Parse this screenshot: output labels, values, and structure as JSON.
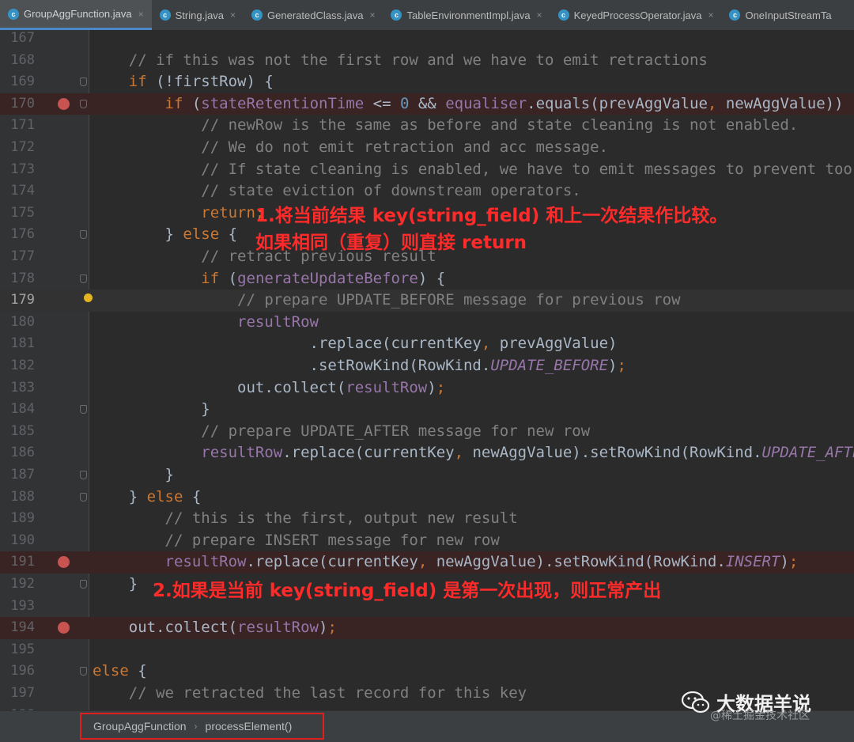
{
  "tabs": [
    {
      "label": "GroupAggFunction.java",
      "active": true
    },
    {
      "label": "String.java",
      "active": false
    },
    {
      "label": "GeneratedClass.java",
      "active": false
    },
    {
      "label": "TableEnvironmentImpl.java",
      "active": false
    },
    {
      "label": "KeyedProcessOperator.java",
      "active": false
    },
    {
      "label": "OneInputStreamTa",
      "active": false
    }
  ],
  "tab_icon_letter": "c",
  "tab_close_glyph": "×",
  "code_lines": [
    {
      "num": "167",
      "tokens": []
    },
    {
      "num": "168",
      "tokens": [
        {
          "t": "    // if this was not the first row and we have to emit retractions",
          "c": "c"
        }
      ]
    },
    {
      "num": "169",
      "tokens": [
        {
          "t": "    "
        },
        {
          "t": "if",
          "c": "k"
        },
        {
          "t": " (!firstRow) {"
        }
      ]
    },
    {
      "num": "170",
      "tokens": [
        {
          "t": "        "
        },
        {
          "t": "if",
          "c": "k"
        },
        {
          "t": " ("
        },
        {
          "t": "stateRetentionTime",
          "c": "f"
        },
        {
          "t": " <= "
        },
        {
          "t": "0",
          "c": "n"
        },
        {
          "t": " && "
        },
        {
          "t": "equaliser",
          "c": "f"
        },
        {
          "t": ".equals(prevAggValue"
        },
        {
          "t": ",",
          "c": "k"
        },
        {
          "t": " newAggValue)) {"
        }
      ]
    },
    {
      "num": "171",
      "tokens": [
        {
          "t": "            // newRow is the same as before and state cleaning is not enabled.",
          "c": "c"
        }
      ]
    },
    {
      "num": "172",
      "tokens": [
        {
          "t": "            // We do not emit retraction and acc message.",
          "c": "c"
        }
      ]
    },
    {
      "num": "173",
      "tokens": [
        {
          "t": "            // If state cleaning is enabled, we have to emit messages to prevent too e",
          "c": "c"
        }
      ]
    },
    {
      "num": "174",
      "tokens": [
        {
          "t": "            // state eviction of downstream operators.",
          "c": "c"
        }
      ]
    },
    {
      "num": "175",
      "tokens": [
        {
          "t": "            "
        },
        {
          "t": "return;",
          "c": "k"
        }
      ]
    },
    {
      "num": "176",
      "tokens": [
        {
          "t": "        } "
        },
        {
          "t": "else",
          "c": "k"
        },
        {
          "t": " {"
        }
      ]
    },
    {
      "num": "177",
      "tokens": [
        {
          "t": "            // retract previous result",
          "c": "c"
        }
      ]
    },
    {
      "num": "178",
      "tokens": [
        {
          "t": "            "
        },
        {
          "t": "if",
          "c": "k"
        },
        {
          "t": " ("
        },
        {
          "t": "generateUpdateBefore",
          "c": "f"
        },
        {
          "t": ") {"
        }
      ]
    },
    {
      "num": "179",
      "tokens": [
        {
          "t": "                // prepare UPDATE_BEFORE message for previous row",
          "c": "c"
        }
      ]
    },
    {
      "num": "180",
      "tokens": [
        {
          "t": "                "
        },
        {
          "t": "resultRow",
          "c": "f"
        }
      ]
    },
    {
      "num": "181",
      "tokens": [
        {
          "t": "                        .replace(currentKey"
        },
        {
          "t": ",",
          "c": "k"
        },
        {
          "t": " prevAggValue)"
        }
      ]
    },
    {
      "num": "182",
      "tokens": [
        {
          "t": "                        .setRowKind(RowKind."
        },
        {
          "t": "UPDATE_BEFORE",
          "c": "it"
        },
        {
          "t": ")"
        },
        {
          "t": ";",
          "c": "k"
        }
      ]
    },
    {
      "num": "183",
      "tokens": [
        {
          "t": "                out.collect("
        },
        {
          "t": "resultRow",
          "c": "f"
        },
        {
          "t": ")"
        },
        {
          "t": ";",
          "c": "k"
        }
      ]
    },
    {
      "num": "184",
      "tokens": [
        {
          "t": "            }"
        }
      ]
    },
    {
      "num": "185",
      "tokens": [
        {
          "t": "            // prepare UPDATE_AFTER message for new row",
          "c": "c"
        }
      ]
    },
    {
      "num": "186",
      "tokens": [
        {
          "t": "            "
        },
        {
          "t": "resultRow",
          "c": "f"
        },
        {
          "t": ".replace(currentKey"
        },
        {
          "t": ",",
          "c": "k"
        },
        {
          "t": " newAggValue).setRowKind(RowKind."
        },
        {
          "t": "UPDATE_AFTER",
          "c": "it"
        }
      ]
    },
    {
      "num": "187",
      "tokens": [
        {
          "t": "        }"
        }
      ]
    },
    {
      "num": "188",
      "tokens": [
        {
          "t": "    } "
        },
        {
          "t": "else",
          "c": "k"
        },
        {
          "t": " {"
        }
      ]
    },
    {
      "num": "189",
      "tokens": [
        {
          "t": "        // this is the first, output new result",
          "c": "c"
        }
      ]
    },
    {
      "num": "190",
      "tokens": [
        {
          "t": "        // prepare INSERT message for new row",
          "c": "c"
        }
      ]
    },
    {
      "num": "191",
      "tokens": [
        {
          "t": "        "
        },
        {
          "t": "resultRow",
          "c": "f"
        },
        {
          "t": ".replace(currentKey"
        },
        {
          "t": ",",
          "c": "k"
        },
        {
          "t": " newAggValue).setRowKind(RowKind."
        },
        {
          "t": "INSERT",
          "c": "it"
        },
        {
          "t": ")"
        },
        {
          "t": ";",
          "c": "k"
        }
      ]
    },
    {
      "num": "192",
      "tokens": [
        {
          "t": "    }"
        }
      ]
    },
    {
      "num": "193",
      "tokens": []
    },
    {
      "num": "194",
      "tokens": [
        {
          "t": "    out.collect("
        },
        {
          "t": "resultRow",
          "c": "f"
        },
        {
          "t": ")"
        },
        {
          "t": ";",
          "c": "k"
        }
      ]
    },
    {
      "num": "195",
      "tokens": []
    },
    {
      "num": "196",
      "tokens": [
        {
          "t": "else",
          "c": "k"
        },
        {
          "t": " {"
        }
      ]
    },
    {
      "num": "197",
      "tokens": [
        {
          "t": "    // we retracted the last record for this key",
          "c": "c"
        }
      ]
    },
    {
      "num": "198",
      "tokens": []
    }
  ],
  "breakpoint_lines": [
    "170",
    "191",
    "194"
  ],
  "caret_line": "179",
  "annotations": {
    "note1_line1": "1.将当前结果 key(string_field) 和上一次结果作比较。",
    "note1_line2": "如果相同（重复）则直接 return",
    "note2": "2.如果是当前 key(string_field) 是第一次出现，则正常产出"
  },
  "breadcrumb": {
    "items": [
      "GroupAggFunction",
      "processElement()"
    ],
    "separator": "›"
  },
  "watermark": {
    "title": "大数据羊说",
    "subtitle": "@稀土掘金技术社区"
  },
  "colors": {
    "editor_bg": "#2b2b2b",
    "keyword": "#cc7832",
    "comment": "#808080",
    "field": "#9876aa",
    "number": "#6897bb",
    "breakpoint": "#c75450",
    "annotation_red": "#ff2a2a"
  }
}
